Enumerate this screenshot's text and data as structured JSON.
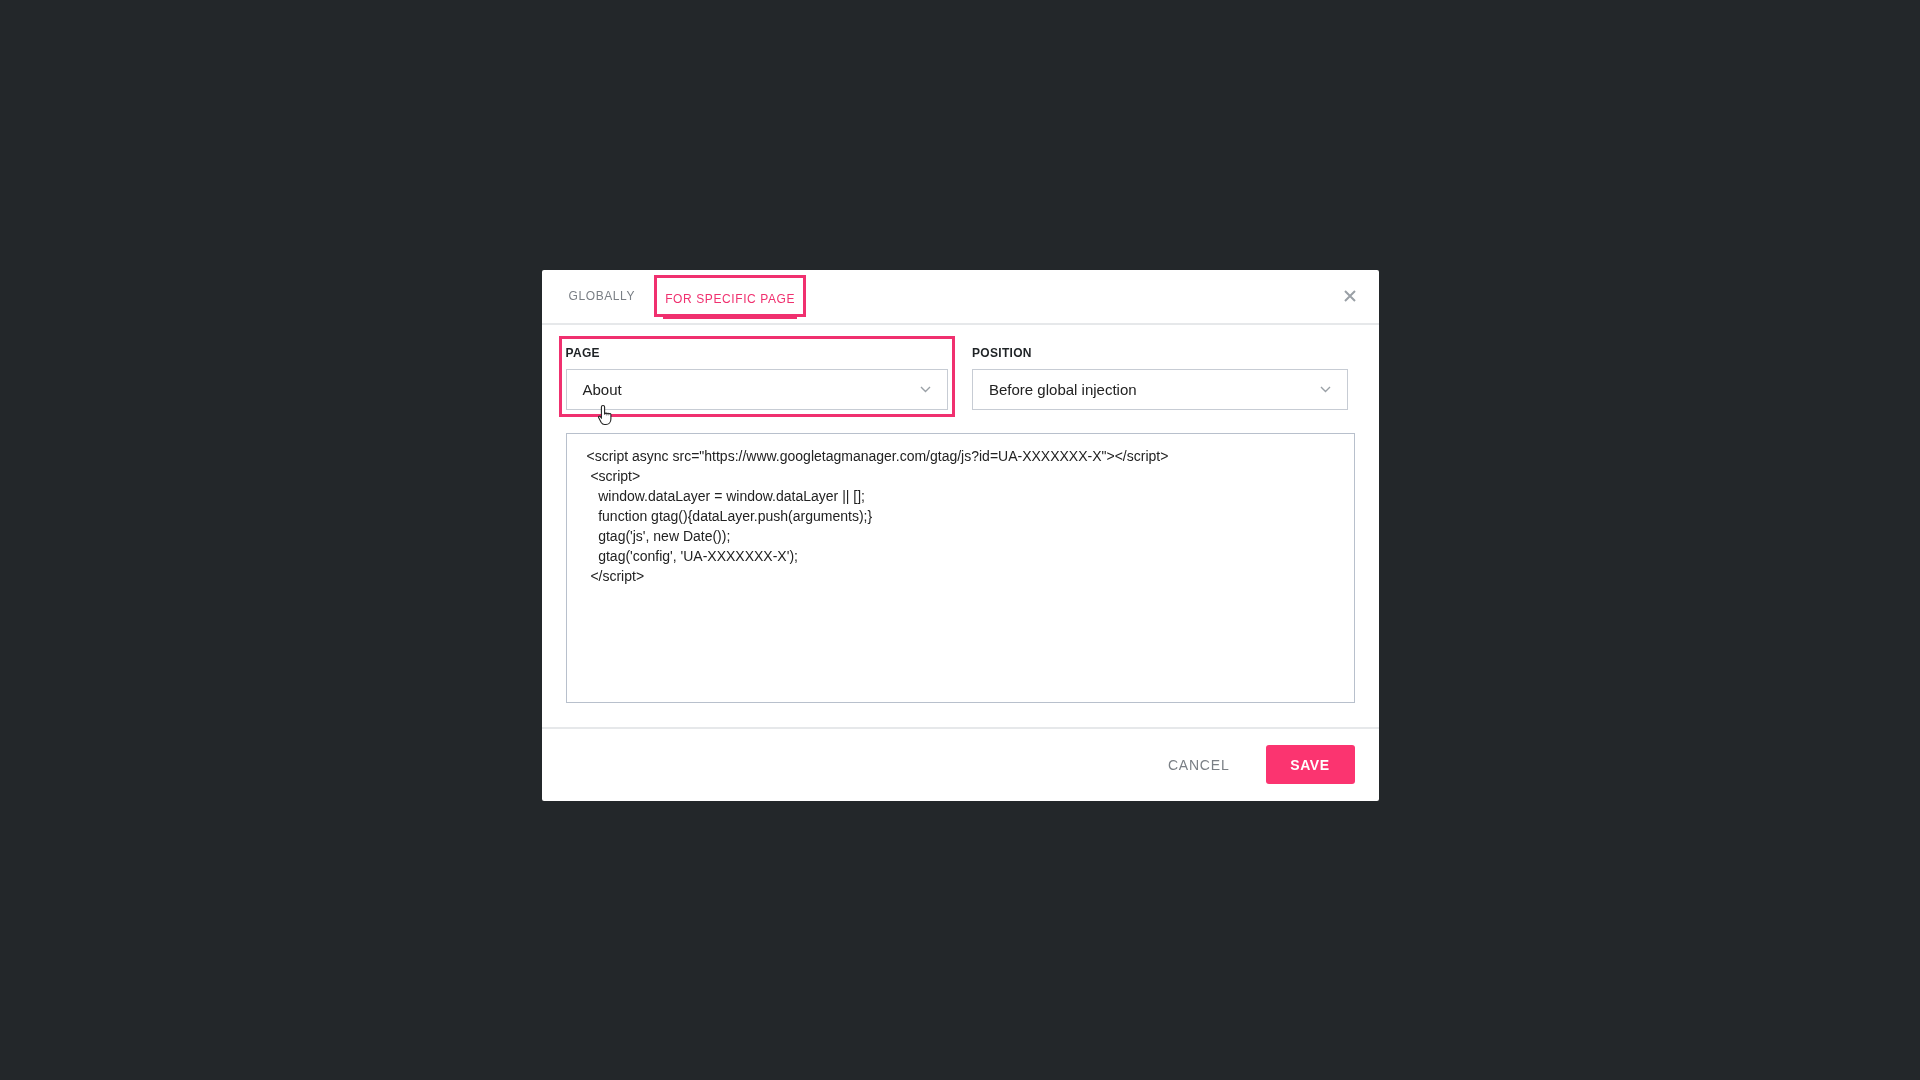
{
  "tabs": [
    {
      "label": "GLOBALLY",
      "selected": false,
      "highlighted": false
    },
    {
      "label": "FOR SPECIFIC PAGE",
      "selected": true,
      "highlighted": true
    }
  ],
  "fields": [
    {
      "label": "PAGE",
      "value": "About",
      "highlighted": true
    },
    {
      "label": "POSITION",
      "value": "Before global injection",
      "highlighted": false
    }
  ],
  "code": "<script async src=\"https://www.googletagmanager.com/gtag/js?id=UA-XXXXXXX-X\"></script>\n <script>\n   window.dataLayer = window.dataLayer || [];\n   function gtag(){dataLayer.push(arguments);}\n   gtag('js', new Date());\n   gtag('config', 'UA-XXXXXXX-X');\n </script>",
  "buttons": [
    {
      "label": "CANCEL",
      "kind": "text"
    },
    {
      "label": "SAVE",
      "kind": "primary"
    }
  ]
}
